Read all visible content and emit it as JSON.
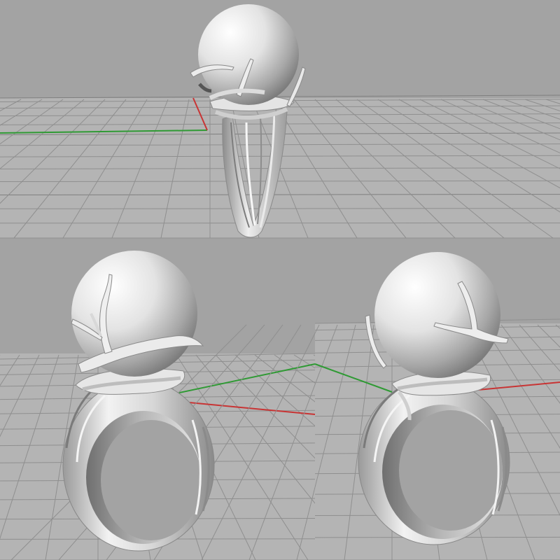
{
  "colors": {
    "background": "#a3a3a3",
    "grid_floor": "#b4b4b4",
    "grid_line": "#8f8f8f",
    "grid_line_major": "#7f7f7f",
    "axis_x": "#c83434",
    "axis_y": "#2f9a34",
    "model_light": "#fbfbfb",
    "model_mid": "#c9c9c9",
    "model_dark": "#808080"
  },
  "scene": {
    "view_count": 3,
    "model": "pearl-ring-with-branch-prongs"
  }
}
